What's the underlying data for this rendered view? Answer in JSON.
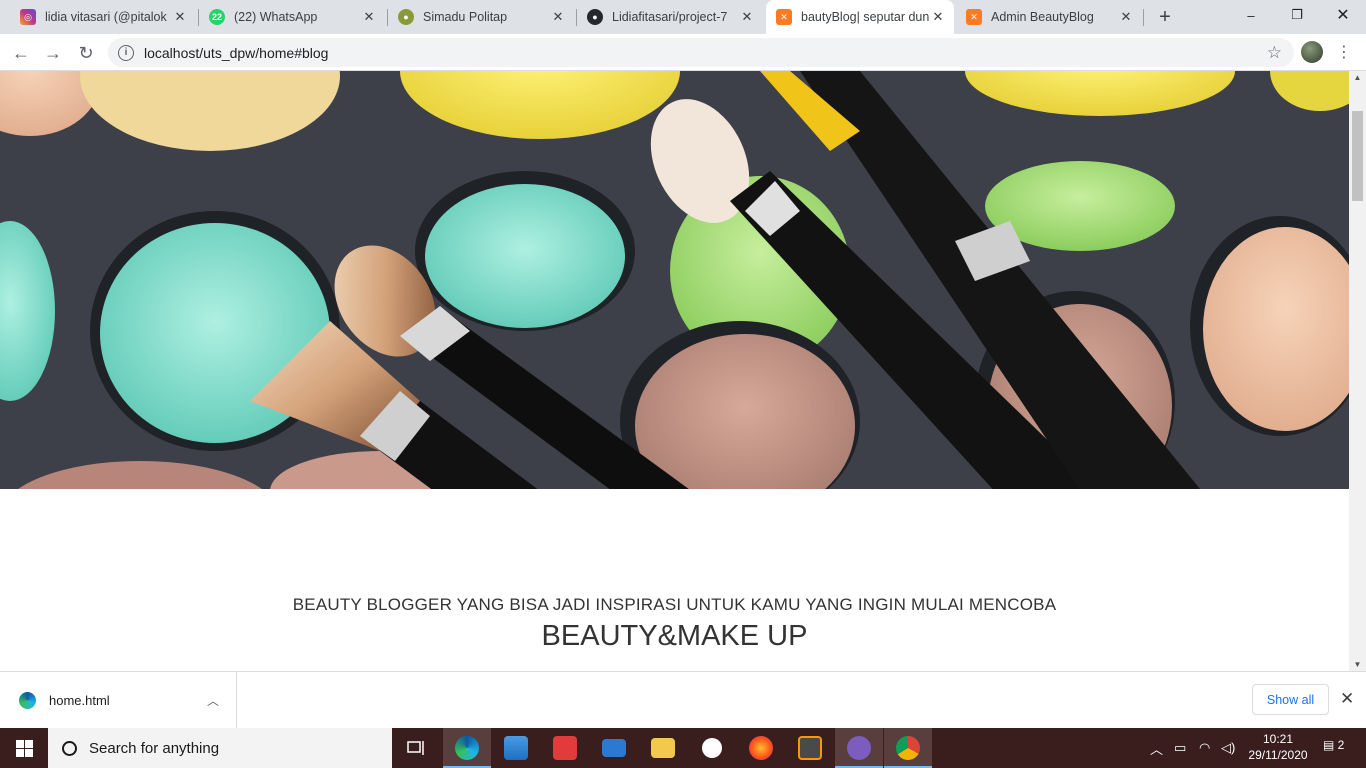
{
  "browser": {
    "tabs": [
      {
        "title": "lidia vitasari (@pitalok",
        "icon": "instagram-icon",
        "color": "#c13584"
      },
      {
        "title": "(22) WhatsApp",
        "icon": "whatsapp-icon",
        "color": "#25d366",
        "badge": "22"
      },
      {
        "title": "Simadu Politap",
        "icon": "politap-icon",
        "color": "#7a8a3a"
      },
      {
        "title": "Lidiafitasari/project-7",
        "icon": "github-icon",
        "color": "#24292e"
      },
      {
        "title": "bautyBlog| seputar dun",
        "icon": "xampp-icon",
        "color": "#fb7a24",
        "active": true
      },
      {
        "title": "Admin BeautyBlog",
        "icon": "xampp-icon",
        "color": "#fb7a24"
      }
    ],
    "url": "localhost/uts_dpw/home#blog",
    "window_controls": {
      "minimize": "–",
      "restore": "❐",
      "close": "✕"
    }
  },
  "page": {
    "hero_alt": "makeup brushes and eyeshadow palette",
    "subtitle": "BEAUTY BLOGGER YANG BISA JADI INSPIRASI UNTUK KAMU YANG INGIN MULAI MENCOBA",
    "title": "BEAUTY&MAKE UP"
  },
  "downloads": {
    "file": "home.html",
    "show_all": "Show all"
  },
  "taskbar": {
    "search_placeholder": "Search for anything",
    "time": "10:21",
    "date": "29/11/2020",
    "notifications": "2"
  }
}
